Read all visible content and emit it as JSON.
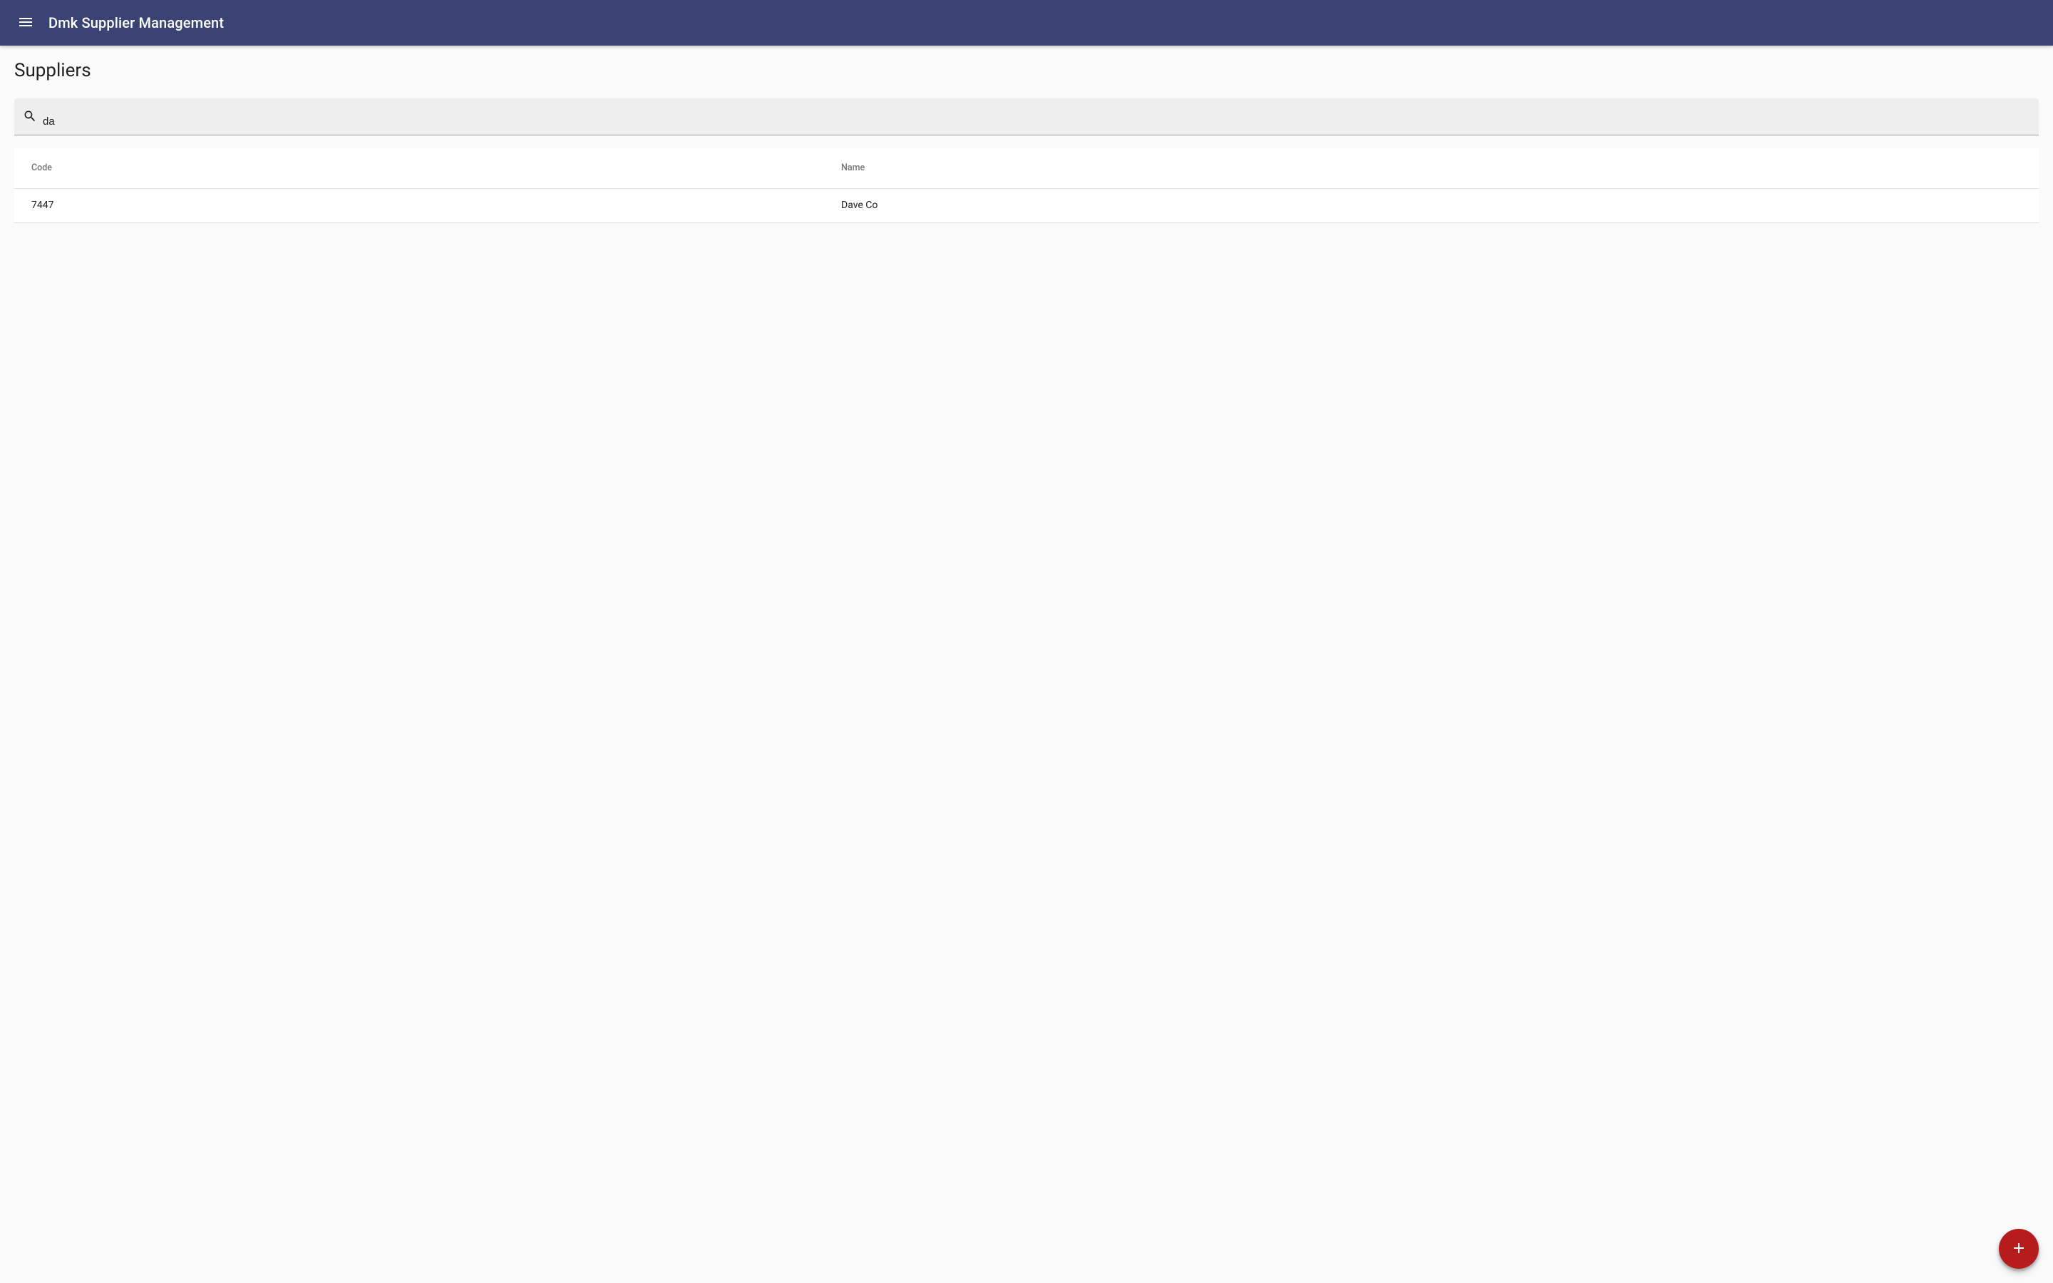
{
  "header": {
    "app_title": "Dmk Supplier Management"
  },
  "page": {
    "title": "Suppliers"
  },
  "search": {
    "value": "da",
    "placeholder": ""
  },
  "table": {
    "columns": {
      "code": "Code",
      "name": "Name"
    },
    "rows": [
      {
        "code": "7447",
        "name": "Dave Co"
      }
    ]
  },
  "colors": {
    "primary": "#3a4372",
    "accent": "#b71c1c",
    "background": "#fafafa"
  }
}
